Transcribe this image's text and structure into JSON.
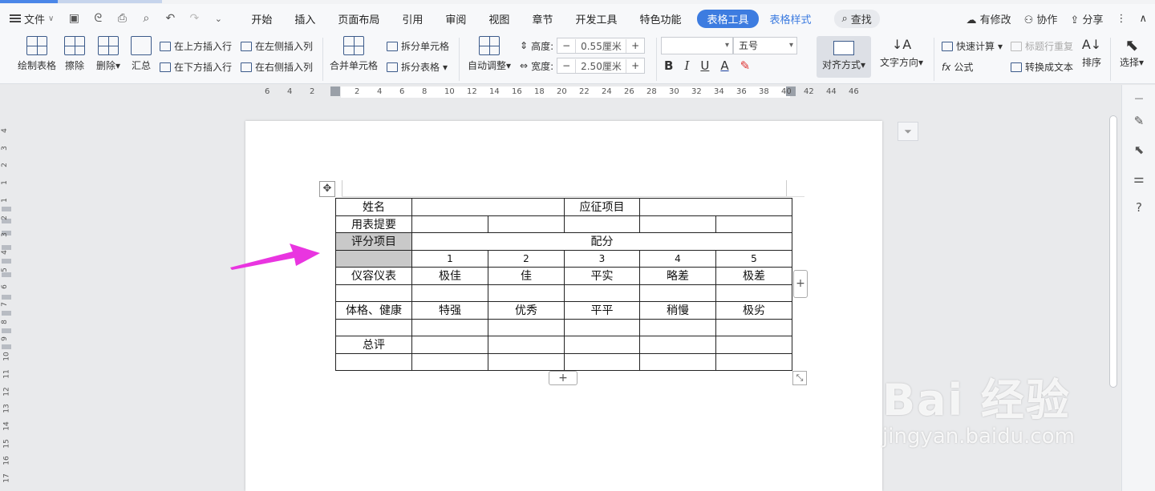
{
  "menubar": {
    "file_label": "文件",
    "tabs": [
      "开始",
      "插入",
      "页面布局",
      "引用",
      "审阅",
      "视图",
      "章节",
      "开发工具",
      "特色功能"
    ],
    "active_tab": "表格工具",
    "table_style_tab": "表格样式",
    "search_label": "查找",
    "right": {
      "changes": "有修改",
      "collab": "协作",
      "share": "分享"
    }
  },
  "ribbon": {
    "draw_table": "绘制表格",
    "erase": "擦除",
    "delete": "删除",
    "summary": "汇总",
    "insert_above": "在上方插入行",
    "insert_below": "在下方插入行",
    "insert_left": "在左侧插入列",
    "insert_right": "在右侧插入列",
    "merge_cells": "合并单元格",
    "split_cells": "拆分单元格",
    "split_table": "拆分表格",
    "auto_fit": "自动调整",
    "height_label": "高度:",
    "height_value": "0.55厘米",
    "width_label": "宽度:",
    "width_value": "2.50厘米",
    "font_name": "",
    "font_size": "五号",
    "align": "对齐方式",
    "text_dir": "文字方向",
    "quick_calc": "快速计算",
    "formula": "公式",
    "repeat_header": "标题行重复",
    "to_text": "转换成文本",
    "sort": "排序",
    "select": "选择"
  },
  "ruler": {
    "h_ticks": [
      "6",
      "4",
      "2",
      "2",
      "4",
      "6",
      "8",
      "10",
      "12",
      "14",
      "16",
      "18",
      "20",
      "22",
      "24",
      "26",
      "28",
      "30",
      "32",
      "34",
      "36",
      "38",
      "40",
      "42",
      "44",
      "46"
    ],
    "v_ticks": [
      "4",
      "3",
      "2",
      "1",
      "1",
      "2",
      "3",
      "4",
      "5",
      "6",
      "7",
      "8",
      "9",
      "10",
      "11",
      "12",
      "13",
      "14",
      "15",
      "16",
      "17"
    ]
  },
  "table": {
    "rows": [
      [
        "姓名",
        "",
        "",
        "应征项目",
        ""
      ],
      [
        "用表提要",
        "",
        "",
        "",
        "",
        ""
      ],
      [
        "评分项目",
        "配分"
      ],
      [
        "",
        "1",
        "2",
        "3",
        "4",
        "5"
      ],
      [
        "仪容仪表",
        "极佳",
        "佳",
        "平实",
        "略差",
        "极差"
      ],
      [
        "",
        "",
        "",
        "",
        "",
        ""
      ],
      [
        "体格、健康",
        "特强",
        "优秀",
        "平平",
        "稍慢",
        "极劣"
      ],
      [
        "",
        "",
        "",
        "",
        "",
        ""
      ],
      [
        "总评",
        "",
        "",
        "",
        "",
        ""
      ],
      [
        "",
        "",
        "",
        "",
        "",
        ""
      ]
    ]
  },
  "watermark": {
    "brand": "Bai 经验",
    "url": "jingyan.baidu.com"
  },
  "colors": {
    "accent": "#3d7ce0",
    "arrow": "#e935e0",
    "header_cell": "#c9c9c9"
  }
}
